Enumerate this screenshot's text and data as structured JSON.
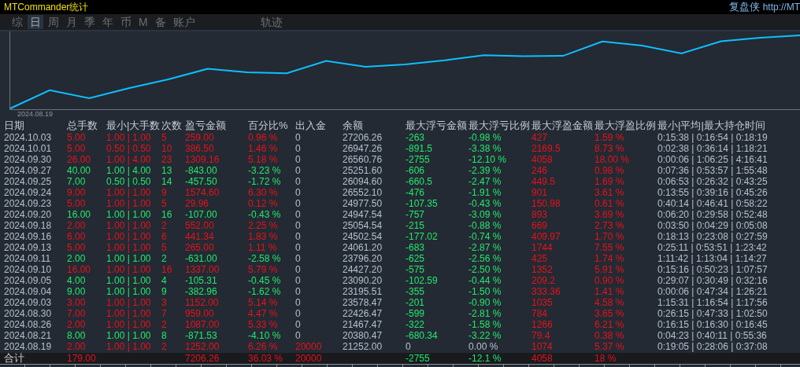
{
  "title": "MTCommander统计",
  "brand": "复盘侠",
  "link": "http://MT",
  "tabs": [
    {
      "label": "综",
      "selected": false
    },
    {
      "label": "日",
      "selected": true
    },
    {
      "label": "周",
      "selected": false
    },
    {
      "label": "月",
      "selected": false
    },
    {
      "label": "季",
      "selected": false
    },
    {
      "label": "年",
      "selected": false
    },
    {
      "label": "币",
      "selected": false
    },
    {
      "label": "M",
      "selected": false
    },
    {
      "label": "备",
      "selected": false
    },
    {
      "label": "账户",
      "selected": false
    },
    {
      "label": "轨迹",
      "selected": false
    }
  ],
  "chart": {
    "start_label": "2024.08.19"
  },
  "table": {
    "columns": [
      "日期",
      "总手数",
      "最小|大手数",
      "次数",
      "盈亏金额",
      "百分比%",
      "出入金",
      "余额",
      "最大浮亏金额",
      "最大浮亏比例",
      "最大浮盈金额",
      "最大浮盈比例",
      "最小|平均|最大持仓时间"
    ],
    "rows": [
      {
        "profitable": true,
        "deposit_flow": false,
        "float_loss": true,
        "cells": [
          "2024.10.03",
          "5.00",
          "1.00 | 1.00",
          "5",
          "259.00",
          "0.96 %",
          "0",
          "27206.26",
          "-263",
          "-0.98 %",
          "427",
          "1.59 %",
          "0:15:38 | 0:16:54 | 0:18:19"
        ]
      },
      {
        "profitable": true,
        "deposit_flow": false,
        "float_loss": true,
        "cells": [
          "2024.10.01",
          "5.00",
          "0.50 | 0.50",
          "10",
          "386.50",
          "1.46 %",
          "0",
          "26947.26",
          "-891.5",
          "-3.38 %",
          "2169.5",
          "8.73 %",
          "0:02:38 | 0:36:14 | 1:18:21"
        ]
      },
      {
        "profitable": true,
        "deposit_flow": false,
        "float_loss": true,
        "cells": [
          "2024.09.30",
          "26.00",
          "1.00 | 4.00",
          "23",
          "1309.16",
          "5.18 %",
          "0",
          "26560.76",
          "-2755",
          "-12.10 %",
          "4058",
          "18.00 %",
          "0:00:06 | 1:06:25 | 4:16:41"
        ]
      },
      {
        "profitable": false,
        "deposit_flow": false,
        "float_loss": true,
        "cells": [
          "2024.09.27",
          "40.00",
          "1.00 | 4.00",
          "13",
          "-843.00",
          "-3.23 %",
          "0",
          "25251.60",
          "-606",
          "-2.39 %",
          "246",
          "0.98 %",
          "0:07:36 | 0:53:57 | 1:55:48"
        ]
      },
      {
        "profitable": false,
        "deposit_flow": false,
        "float_loss": true,
        "cells": [
          "2024.09.25",
          "7.00",
          "0.50 | 0.50",
          "14",
          "-457.50",
          "-1.72 %",
          "0",
          "26094.60",
          "-660.5",
          "-2.47 %",
          "449.5",
          "1.69 %",
          "0:06:53 | 0:26:32 | 0:43:25"
        ]
      },
      {
        "profitable": true,
        "deposit_flow": false,
        "float_loss": true,
        "cells": [
          "2024.09.24",
          "9.00",
          "1.00 | 1.00",
          "9",
          "1574.60",
          "6.30 %",
          "0",
          "26552.10",
          "-476",
          "-1.91 %",
          "901",
          "3.61 %",
          "0:13:55 | 0:39:16 | 0:45:26"
        ]
      },
      {
        "profitable": true,
        "deposit_flow": false,
        "float_loss": true,
        "cells": [
          "2024.09.23",
          "5.00",
          "1.00 | 1.00",
          "5",
          "29.96",
          "0.12 %",
          "0",
          "24977.50",
          "-107.35",
          "-0.43 %",
          "150.98",
          "0.61 %",
          "0:40:14 | 0:46:41 | 0:58:22"
        ]
      },
      {
        "profitable": false,
        "deposit_flow": false,
        "float_loss": true,
        "cells": [
          "2024.09.20",
          "16.00",
          "1.00 | 1.00",
          "16",
          "-107.00",
          "-0.43 %",
          "0",
          "24947.54",
          "-757",
          "-3.09 %",
          "893",
          "3.69 %",
          "0:06:20 | 0:29:58 | 0:52:48"
        ]
      },
      {
        "profitable": true,
        "deposit_flow": false,
        "float_loss": true,
        "cells": [
          "2024.09.18",
          "2.00",
          "1.00 | 1.00",
          "2",
          "552.00",
          "2.25 %",
          "0",
          "25054.54",
          "-215",
          "-0.88 %",
          "669",
          "2.73 %",
          "0:03:50 | 0:04:29 | 0:05:08"
        ]
      },
      {
        "profitable": true,
        "deposit_flow": false,
        "float_loss": true,
        "cells": [
          "2024.09.16",
          "6.00",
          "1.00 | 1.00",
          "6",
          "441.34",
          "1.83 %",
          "0",
          "24502.54",
          "-177.02",
          "-0.74 %",
          "409.97",
          "1.70 %",
          "0:18:13 | 0:23:08 | 0:27:59"
        ]
      },
      {
        "profitable": true,
        "deposit_flow": false,
        "float_loss": true,
        "cells": [
          "2024.09.13",
          "5.00",
          "1.00 | 1.00",
          "5",
          "265.00",
          "1.11 %",
          "0",
          "24061.20",
          "-683",
          "-2.87 %",
          "1744",
          "7.55 %",
          "0:25:11 | 0:53:51 | 1:23:42"
        ]
      },
      {
        "profitable": false,
        "deposit_flow": false,
        "float_loss": true,
        "cells": [
          "2024.09.11",
          "2.00",
          "1.00 | 1.00",
          "2",
          "-631.00",
          "-2.58 %",
          "0",
          "23796.20",
          "-625",
          "-2.56 %",
          "425",
          "1.74 %",
          "1:11:42 | 1:13:04 | 1:14:27"
        ]
      },
      {
        "profitable": true,
        "deposit_flow": false,
        "float_loss": true,
        "cells": [
          "2024.09.10",
          "16.00",
          "1.00 | 1.00",
          "16",
          "1337.00",
          "5.79 %",
          "0",
          "24427.20",
          "-575",
          "-2.50 %",
          "1352",
          "5.91 %",
          "0:15:16 | 0:50:23 | 1:07:57"
        ]
      },
      {
        "profitable": false,
        "deposit_flow": false,
        "float_loss": true,
        "cells": [
          "2024.09.05",
          "4.00",
          "1.00 | 1.00",
          "4",
          "-105.31",
          "-0.45 %",
          "0",
          "23090.20",
          "-102.59",
          "-0.44 %",
          "209.2",
          "0.90 %",
          "0:29:07 | 0:30:49 | 0:32:16"
        ]
      },
      {
        "profitable": false,
        "deposit_flow": false,
        "float_loss": true,
        "cells": [
          "2024.09.04",
          "9.00",
          "1.00 | 1.00",
          "9",
          "-382.96",
          "-1.62 %",
          "0",
          "23195.51",
          "-355",
          "-1.50 %",
          "333.36",
          "1.41 %",
          "0:00:06 | 0:47:34 | 1:26:21"
        ]
      },
      {
        "profitable": true,
        "deposit_flow": false,
        "float_loss": true,
        "cells": [
          "2024.09.03",
          "3.00",
          "1.00 | 1.00",
          "3",
          "1152.00",
          "5.14 %",
          "0",
          "23578.47",
          "-201",
          "-0.90 %",
          "1035",
          "4.58 %",
          "1:15:31 | 1:16:54 | 1:17:56"
        ]
      },
      {
        "profitable": true,
        "deposit_flow": false,
        "float_loss": true,
        "cells": [
          "2024.08.30",
          "7.00",
          "1.00 | 1.00",
          "7",
          "959.00",
          "4.47 %",
          "0",
          "22426.47",
          "-599",
          "-2.81 %",
          "784",
          "3.65 %",
          "0:26:15 | 0:47:33 | 1:02:50"
        ]
      },
      {
        "profitable": true,
        "deposit_flow": false,
        "float_loss": true,
        "cells": [
          "2024.08.26",
          "2.00",
          "1.00 | 1.00",
          "2",
          "1087.00",
          "5.33 %",
          "0",
          "21467.47",
          "-322",
          "-1.58 %",
          "1266",
          "6.21 %",
          "0:16:15 | 0:16:30 | 0:16:45"
        ]
      },
      {
        "profitable": false,
        "deposit_flow": false,
        "float_loss": true,
        "cells": [
          "2024.08.21",
          "8.00",
          "1.00 | 1.00",
          "8",
          "-871.53",
          "-4.10 %",
          "0",
          "20380.47",
          "-680.34",
          "-3.22 %",
          "79.4",
          "0.38 %",
          "0:04:23 | 0:40:11 | 0:55:36"
        ]
      },
      {
        "profitable": true,
        "deposit_flow": true,
        "float_loss": false,
        "cells": [
          "2024.08.19",
          "2.00",
          "1.00 | 1.00",
          "2",
          "1252.00",
          "6.26 %",
          "20000",
          "21252.00",
          "0",
          "0.00 %",
          "1074",
          "5.37 %",
          "0:19:05 | 0:28:06 | 0:37:08"
        ]
      }
    ],
    "total": {
      "label": "合计",
      "lots": "179.00",
      "pnl": "7206.26",
      "pct": "36.03 %",
      "deposit": "20000",
      "max_float_loss": "-2755",
      "max_float_loss_pct": "-12.1 %",
      "max_float_profit": "4058",
      "max_float_profit_pct": "18 %"
    }
  }
}
